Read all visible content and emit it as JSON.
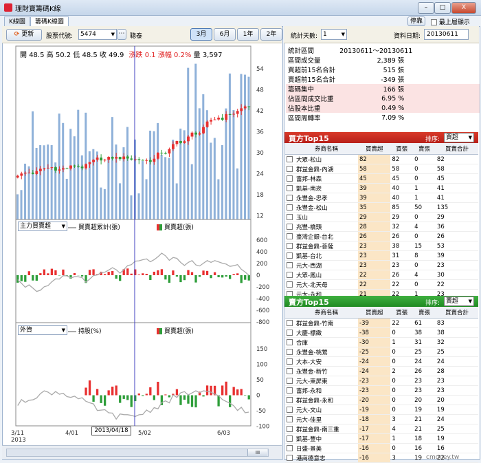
{
  "window": {
    "title": "理財寶籌碼K線",
    "close_label": "X"
  },
  "tabs": [
    {
      "label": "K線圖"
    },
    {
      "label": "籌碼K線圖"
    }
  ],
  "topbar": {
    "dock_label": "停靠",
    "ontop_label": "最上層顯示"
  },
  "toolbar": {
    "refresh_label": "更新",
    "code_label": "股票代號:",
    "code_value": "5474",
    "more_label": "⋯",
    "stock_name": "聰泰",
    "ranges": [
      "3月",
      "6月",
      "1年",
      "2年"
    ],
    "active_range": "3月"
  },
  "ohlc": {
    "open_label": "開",
    "open": "48.5",
    "high_label": "高",
    "high": "50.2",
    "low_label": "低",
    "low": "48.5",
    "close_label": "收",
    "close": "49.9",
    "chg_label": "漲跌",
    "chg": "0.1",
    "pct_label": "漲幅",
    "pct": "0.2%",
    "vol_label": "量",
    "vol": "3,597"
  },
  "chart_data": {
    "type": "candlestick-volume-bar-line",
    "price_ticks": [
      "54",
      "48",
      "42",
      "36",
      "30",
      "24",
      "18",
      "12"
    ],
    "panel2": {
      "selector": "主力買賣超",
      "legend_line": "買賣超累計(張)",
      "legend_bar": "買賣超(張)",
      "ticks": [
        "600",
        "400",
        "200",
        "0",
        "-200",
        "-400",
        "-600",
        "-800"
      ]
    },
    "panel3": {
      "selector": "外資",
      "legend_line": "持股(%)",
      "legend_bar": "買賣超(張)",
      "ticks": [
        "150",
        "100",
        "50",
        "0",
        "-50",
        "-100"
      ]
    },
    "x_labels": [
      "3/11\n2013",
      "4/01",
      "5/02",
      "6/03"
    ],
    "cursor_label": "2013/04/18",
    "colors": {
      "up": "#e83030",
      "down": "#2e9e3a",
      "volume": "#8fb1d9",
      "cursor": "#4040c0",
      "line": "#aaaaaa"
    }
  },
  "right": {
    "days_label": "統計天數:",
    "days_value": "1",
    "date_label": "資料日期:",
    "date_value": "20130611",
    "stats": [
      {
        "k": "統計區間",
        "v": "20130611～20130611",
        "hl": false
      },
      {
        "k": "區間成交量",
        "v": "2,389 張",
        "hl": false
      },
      {
        "k": "買超前15名合計",
        "v": "515 張",
        "hl": false
      },
      {
        "k": "賣超前15名合計",
        "v": "-349 張",
        "hl": false
      },
      {
        "k": "籌碼集中",
        "v": "166 張",
        "hl": true
      },
      {
        "k": "佔區間成交比重",
        "v": "6.95 %",
        "hl": true
      },
      {
        "k": "佔股本比重",
        "v": "0.49 %",
        "hl": true
      },
      {
        "k": "區間周轉率",
        "v": "7.09 %",
        "hl": false
      }
    ],
    "buy": {
      "title": "買方Top15",
      "sort_label": "排序:",
      "sort_value": "買超",
      "columns": [
        "券商名稱",
        "買賣超",
        "買張",
        "賣張",
        "買賣合計"
      ],
      "rows": [
        [
          "大眾-松山",
          "82",
          "82",
          "0",
          "82"
        ],
        [
          "群益金鼎-內湖",
          "58",
          "58",
          "0",
          "58"
        ],
        [
          "富邦-林森",
          "45",
          "45",
          "0",
          "45"
        ],
        [
          "凱基-南崁",
          "39",
          "40",
          "1",
          "41"
        ],
        [
          "永豐金-忠孝",
          "39",
          "40",
          "1",
          "41"
        ],
        [
          "永豐金-松山",
          "35",
          "85",
          "50",
          "135"
        ],
        [
          "玉山",
          "29",
          "29",
          "0",
          "29"
        ],
        [
          "兆豐-橋頭",
          "28",
          "32",
          "4",
          "36"
        ],
        [
          "臺灣企銀-台北",
          "26",
          "26",
          "0",
          "26"
        ],
        [
          "群益金鼎-菩薩",
          "23",
          "38",
          "15",
          "53"
        ],
        [
          "凱基-台北",
          "23",
          "31",
          "8",
          "39"
        ],
        [
          "元大-西湖",
          "23",
          "23",
          "0",
          "23"
        ],
        [
          "大眾-鳳山",
          "22",
          "26",
          "4",
          "30"
        ],
        [
          "元大-北天母",
          "22",
          "22",
          "0",
          "22"
        ],
        [
          "元大-永和",
          "21",
          "22",
          "1",
          "23"
        ]
      ]
    },
    "sell": {
      "title": "賣方Top15",
      "sort_label": "排序:",
      "sort_value": "賣超",
      "columns": [
        "券商名稱",
        "買賣超",
        "買張",
        "賣張",
        "買賣合計"
      ],
      "rows": [
        [
          "群益金鼎-竹南",
          "-39",
          "22",
          "61",
          "83"
        ],
        [
          "大慶-標緻",
          "-38",
          "0",
          "38",
          "38"
        ],
        [
          "合庫",
          "-30",
          "1",
          "31",
          "32"
        ],
        [
          "永豐金-桃鶯",
          "-25",
          "0",
          "25",
          "25"
        ],
        [
          "大本-大安",
          "-24",
          "0",
          "24",
          "24"
        ],
        [
          "永豐金-新竹",
          "-24",
          "2",
          "26",
          "28"
        ],
        [
          "元大-東屏東",
          "-23",
          "0",
          "23",
          "23"
        ],
        [
          "富邦-永和",
          "-23",
          "0",
          "23",
          "23"
        ],
        [
          "群益金鼎-永和",
          "-20",
          "0",
          "20",
          "20"
        ],
        [
          "元大-文山",
          "-19",
          "0",
          "19",
          "19"
        ],
        [
          "元大-佳里",
          "-18",
          "3",
          "21",
          "24"
        ],
        [
          "群益金鼎-南三重",
          "-17",
          "4",
          "21",
          "25"
        ],
        [
          "凱基-豐中",
          "-17",
          "1",
          "18",
          "19"
        ],
        [
          "日盛-景美",
          "-16",
          "0",
          "16",
          "16"
        ],
        [
          "港商德意志",
          "-16",
          "3",
          "19",
          "22"
        ]
      ]
    }
  },
  "statusbar": {
    "scroll_label": "III"
  },
  "watermark": "cmoney.tw"
}
